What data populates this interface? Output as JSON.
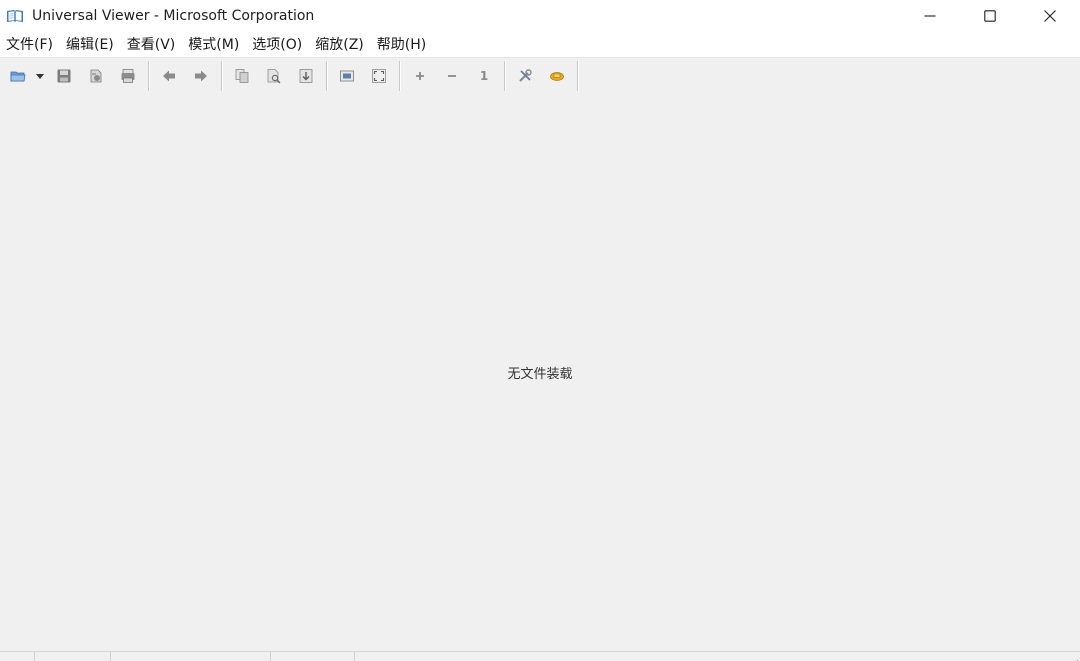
{
  "window": {
    "title": "Universal Viewer - Microsoft Corporation"
  },
  "menu": {
    "items": [
      {
        "label": "文件(F)"
      },
      {
        "label": "编辑(E)"
      },
      {
        "label": "查看(V)"
      },
      {
        "label": "模式(M)"
      },
      {
        "label": "选项(O)"
      },
      {
        "label": "缩放(Z)"
      },
      {
        "label": "帮助(H)"
      }
    ]
  },
  "toolbar": {
    "zoom_original_label": "1"
  },
  "content": {
    "empty_message": "无文件装载"
  },
  "colors": {
    "background": "#f0f0f0",
    "titlebar": "#ffffff",
    "accent_icon": "#3b78c4",
    "toolbar_icon": "#8a8a8a",
    "tools_icon": "#e0a020"
  }
}
